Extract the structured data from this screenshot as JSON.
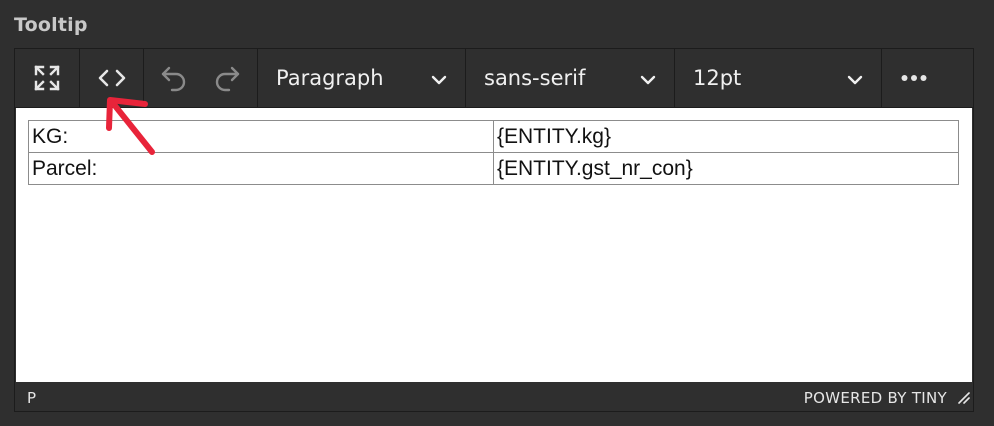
{
  "field": {
    "label": "Tooltip"
  },
  "toolbar": {
    "icons": {
      "fullscreen": "fullscreen-icon",
      "source_code": "source-code-icon",
      "undo": "undo-icon",
      "redo": "redo-icon",
      "more": "more-icon"
    },
    "block_format": "Paragraph",
    "font_family": "sans-serif",
    "font_size": "12pt"
  },
  "content": {
    "rows": [
      {
        "label": "KG:",
        "value": "{ENTITY.kg}"
      },
      {
        "label": "Parcel:",
        "value": "{ENTITY.gst_nr_con}"
      }
    ]
  },
  "statusbar": {
    "path": "P",
    "brand": "POWERED BY TINY"
  },
  "colors": {
    "chrome": "#2f2f2f",
    "content_bg": "#ffffff",
    "annotation_arrow": "#e8243a"
  }
}
